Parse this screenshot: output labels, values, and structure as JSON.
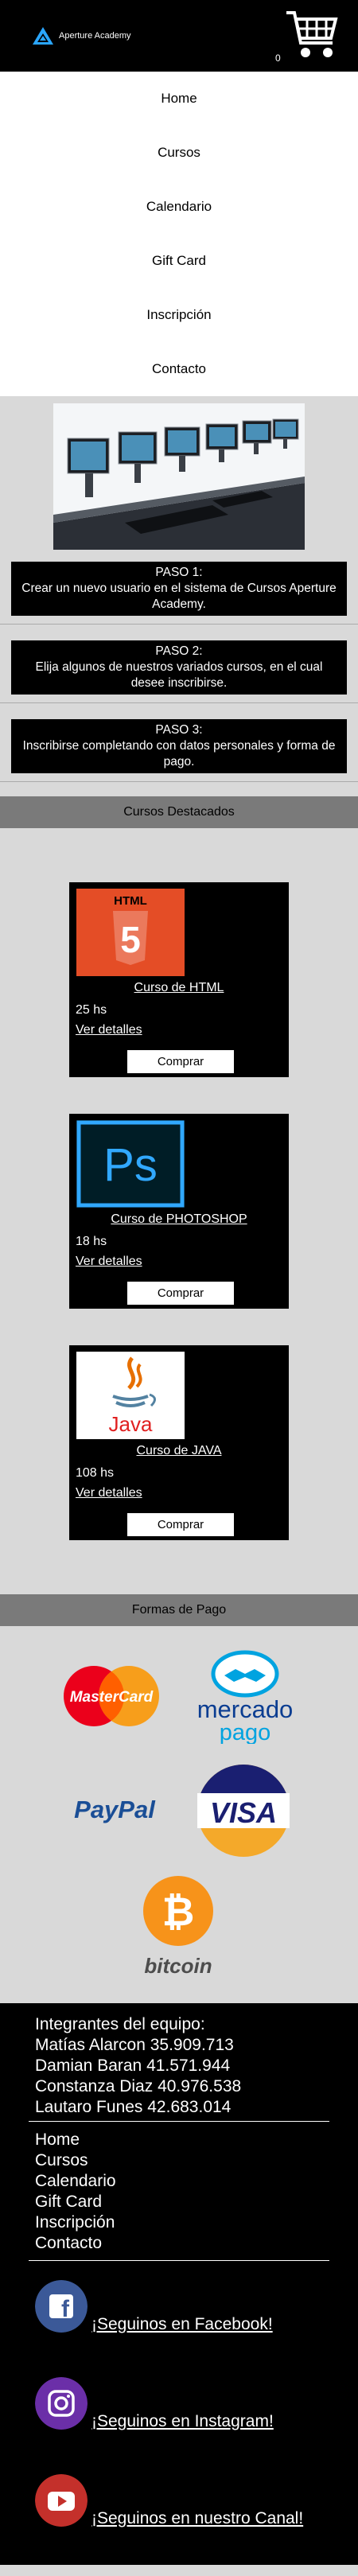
{
  "header": {
    "brand": "Aperture Academy",
    "cart_count": "0"
  },
  "nav": {
    "items": [
      "Home",
      "Cursos",
      "Calendario",
      "Gift Card",
      "Inscripción",
      "Contacto"
    ]
  },
  "steps": [
    {
      "title": "PASO 1:",
      "text": "Crear un nuevo usuario en el sistema de Cursos Aperture Academy."
    },
    {
      "title": "PASO 2:",
      "text": "Elija algunos de nuestros variados cursos, en el cual desee inscribirse."
    },
    {
      "title": "PASO 3:",
      "text": "Inscribirse completando con datos personales y forma de pago."
    }
  ],
  "featured": {
    "title": "Cursos Destacados",
    "courses": [
      {
        "name": "Curso de HTML",
        "hours": "25 hs",
        "details": "Ver detalles",
        "buy": "Comprar",
        "badge": "HTML"
      },
      {
        "name": "Curso de PHOTOSHOP",
        "hours": "18 hs",
        "details": "Ver detalles",
        "buy": "Comprar",
        "badge": "Ps"
      },
      {
        "name": "Curso de JAVA",
        "hours": "108 hs",
        "details": "Ver detalles",
        "buy": "Comprar",
        "badge": "Java"
      }
    ]
  },
  "payments": {
    "title": "Formas de Pago",
    "mastercard": "MasterCard",
    "mercado_line1": "mercado",
    "mercado_line2": "pago",
    "paypal": "PayPal",
    "visa": "VISA",
    "bitcoin": "bitcoin",
    "bitcoin_symbol": "₿"
  },
  "footer": {
    "team_title": "Integrantes del equipo:",
    "members": [
      "Matías Alarcon 35.909.713",
      "Damian Baran 41.571.944",
      "Constanza Diaz 40.976.538",
      "Lautaro Funes 42.683.014"
    ],
    "links": [
      "Home",
      "Cursos",
      "Calendario",
      "Gift Card",
      "Inscripción",
      "Contacto"
    ],
    "social": [
      {
        "label": "¡Seguinos en Facebook!",
        "icon": "f",
        "color": "#3b5998"
      },
      {
        "label": "¡Seguinos en Instagram!",
        "icon": "instagram",
        "color": "#6b2fa8"
      },
      {
        "label": "¡Seguinos en nuestro Canal!",
        "icon": "youtube",
        "color": "#c4302b"
      }
    ]
  }
}
